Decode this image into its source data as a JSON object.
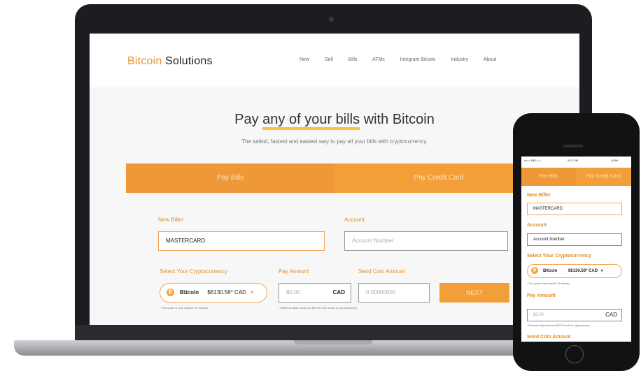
{
  "laptop": {
    "brand_main": "Bitcoin",
    "brand_rest": " Solutions",
    "nav": [
      "New",
      "Sell",
      "Bills",
      "ATMs",
      "Integrate Bitcoin",
      "Industry",
      "About"
    ],
    "headline_pre": "Pay ",
    "headline_hl": "any of your bills",
    "headline_post": " with Bitcoin",
    "subline": "The safest, fastest and easiest way to pay all your bills with cryptocurrency.",
    "tab_bills": "Pay Bills",
    "tab_card": "Pay Credit Card",
    "label_biller": "New Biller",
    "value_biller": "MASTERCARD",
    "label_account": "Account",
    "placeholder_account": "Account Number",
    "label_crypto": "Select Your Cryptocurrency",
    "crypto_name": "Bitcoin",
    "crypto_rate": "$6130.56* CAD",
    "crypto_caret": "▾",
    "label_amount": "Pay Amount",
    "amount_value": "$0.00",
    "amount_currency": "CAD",
    "label_send": "Send Coin Amount",
    "send_value": "0.00000000",
    "next_label": "NEXT",
    "note_crypto": "* This quote is only valid for 15 minutes.",
    "note_amount": "* Minimum daily amount is $20.00 CAD worth of cryptocurrency"
  },
  "phone": {
    "carrier": "•••○○ BELL ≈",
    "time": "4:21 PM",
    "battery": "100%",
    "tab_bills": "Pay Bills",
    "tab_card": "Pay Credit Card",
    "label_biller": "New Biller",
    "value_biller": "MASTERCARD",
    "label_account": "Account",
    "placeholder_account": "Account Number",
    "label_crypto": "Select Your Cryptocurrency",
    "crypto_name": "Bitcoin",
    "crypto_rate": "$6130.56* CAD",
    "crypto_caret": "▾",
    "note_crypto": "* This quote is only valid for 15 minutes.",
    "label_amount": "Pay Amount",
    "amount_value": "$0.00",
    "amount_currency": "CAD",
    "note_amount": "* Minimum daily amount is $20.00 worth of cryptocurrency",
    "label_send": "Send Coin Amount"
  },
  "colors": {
    "accent": "#f29f3a",
    "highlight": "#f6c243",
    "label": "#e88b24"
  }
}
